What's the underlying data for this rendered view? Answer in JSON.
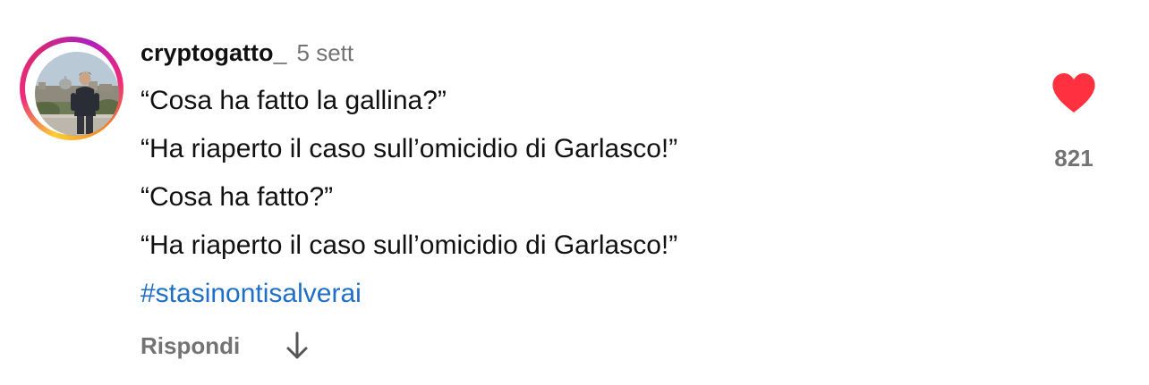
{
  "comment": {
    "author": "cryptogatto_",
    "time": "5 sett",
    "lines": [
      "“Cosa ha fatto la gallina?”",
      "“Ha riaperto il caso sull’omicidio di Garlasco!”",
      "“Cosa ha fatto?”",
      "“Ha riaperto il caso sull’omicidio di Garlasco!”"
    ],
    "hashtag": "#stasinontisalverai",
    "reply_label": "Rispondi",
    "like_count": "821",
    "liked": true
  },
  "icons": {
    "like": "heart-icon",
    "translate": "arrow-down-icon"
  },
  "colors": {
    "heart": "#ff3040",
    "hashtag": "#1f6fc6",
    "secondary_text": "#737373"
  }
}
